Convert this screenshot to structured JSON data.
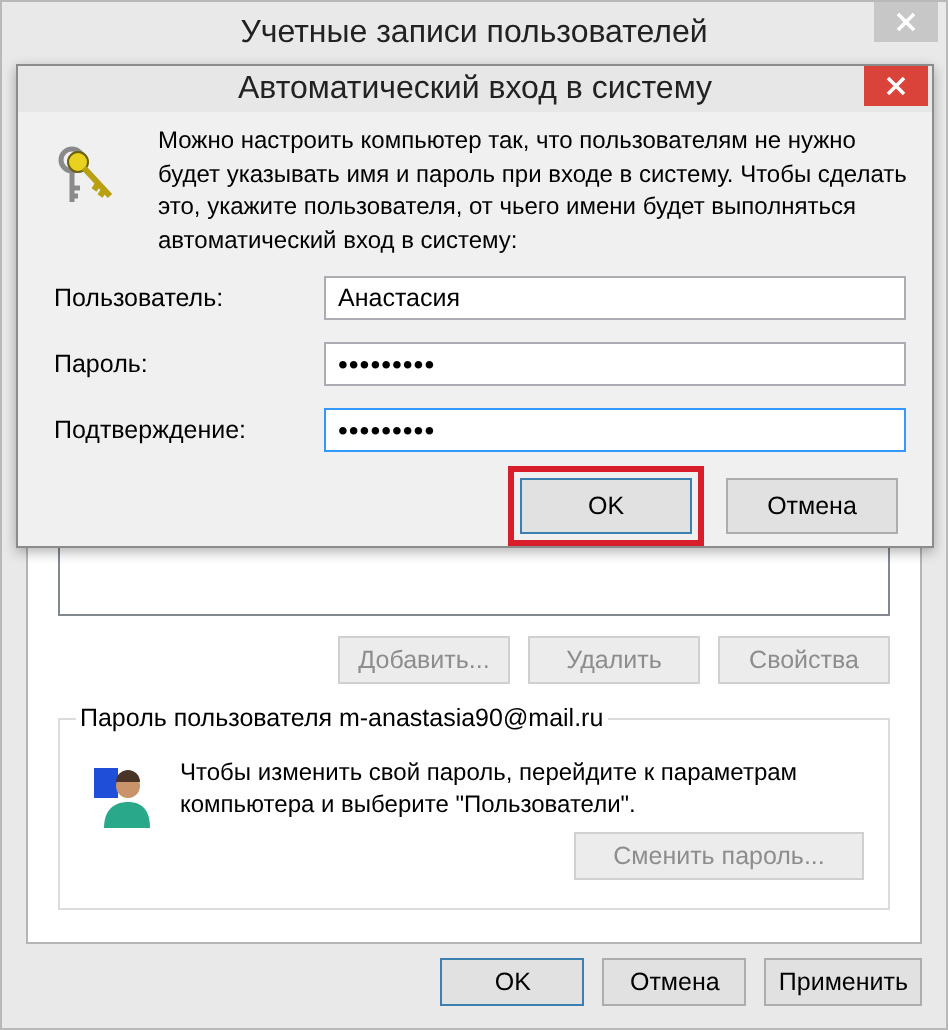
{
  "window": {
    "title": "Учетные записи пользователей"
  },
  "user_buttons": [
    {
      "label": "Добавить...",
      "disabled": true
    },
    {
      "label": "Удалить",
      "disabled": true
    },
    {
      "label": "Свойства",
      "disabled": true
    }
  ],
  "password_group": {
    "title": "Пароль пользователя m-anastasia90@mail.ru",
    "text": "Чтобы изменить свой пароль, перейдите к параметрам компьютера и выберите \"Пользователи\".",
    "button": {
      "label": "Сменить пароль...",
      "disabled": true
    }
  },
  "footer_buttons": [
    {
      "label": "OK",
      "default": true
    },
    {
      "label": "Отмена",
      "default": false
    },
    {
      "label": "Применить",
      "default": false
    }
  ],
  "dialog": {
    "title": "Автоматический вход в систему",
    "description": "Можно настроить компьютер так, что пользователям не нужно будет указывать имя и пароль при входе в систему. Чтобы сделать это, укажите пользователя, от чьего имени будет выполняться автоматический вход в систему:",
    "fields": [
      {
        "label": "Пользователь:",
        "value": "Анастасия",
        "kind": "text",
        "focused": false
      },
      {
        "label": "Пароль:",
        "value": "•••••••••",
        "kind": "password",
        "focused": false
      },
      {
        "label": "Подтверждение:",
        "value": "•••••••••",
        "kind": "password",
        "focused": true
      }
    ],
    "buttons": [
      {
        "label": "OK",
        "default": true,
        "highlighted": true
      },
      {
        "label": "Отмена",
        "default": false,
        "highlighted": false
      }
    ]
  }
}
